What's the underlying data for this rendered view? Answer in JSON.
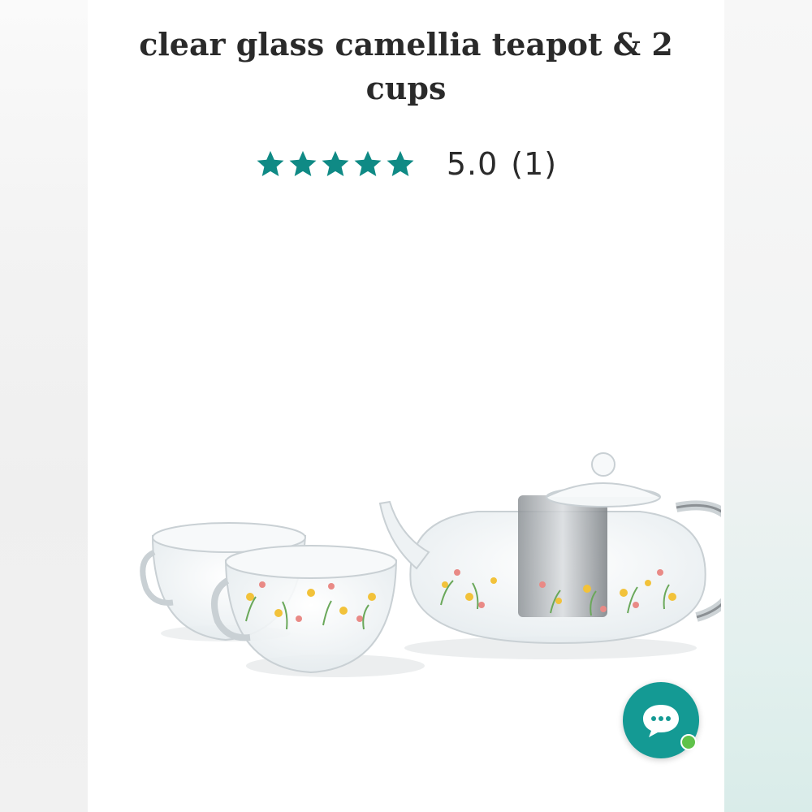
{
  "product": {
    "title": "clear glass camellia teapot & 2 cups",
    "rating": {
      "stars": 5,
      "max_stars": 5,
      "value": "5.0",
      "count": "(1)",
      "star_color": "#0f8a85"
    },
    "image": {
      "icon": "teapot-and-cups-image"
    }
  },
  "chat": {
    "icon": "chat-bubble-icon",
    "color": "#149a94",
    "status_color": "#5fc24a"
  }
}
